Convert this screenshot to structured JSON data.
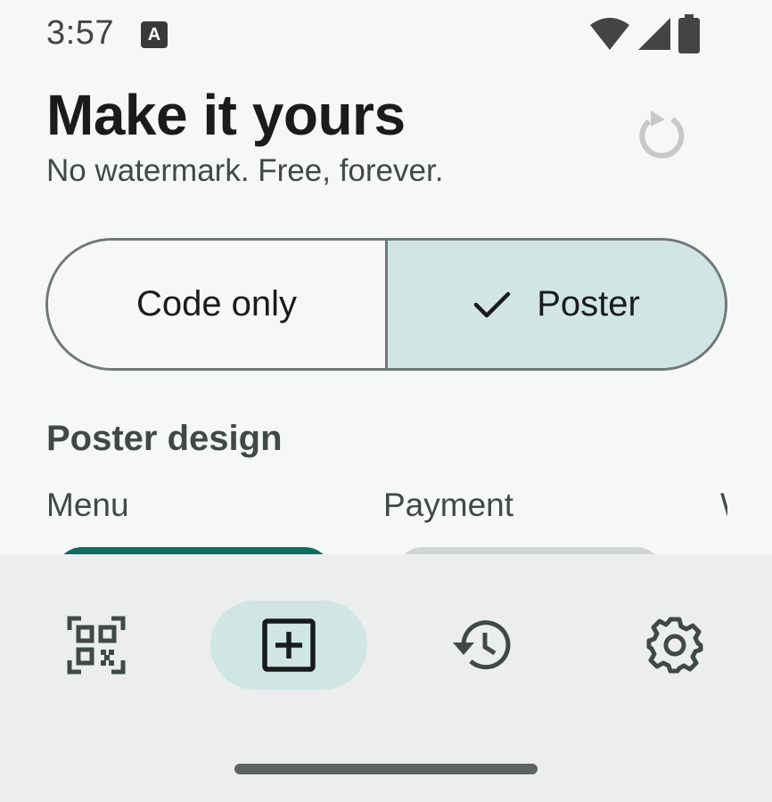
{
  "status": {
    "time": "3:57",
    "notification_badge": "A"
  },
  "header": {
    "title": "Make it yours",
    "subtitle": "No watermark. Free, forever."
  },
  "toggle": {
    "options": [
      {
        "label": "Code only",
        "selected": false
      },
      {
        "label": "Poster",
        "selected": true
      }
    ]
  },
  "poster": {
    "section_title": "Poster design",
    "designs": [
      "Menu",
      "Payment",
      "W"
    ]
  },
  "bottom_nav": {
    "items": [
      {
        "icon": "qr-scan-icon",
        "selected": false
      },
      {
        "icon": "add-box-icon",
        "selected": true
      },
      {
        "icon": "history-icon",
        "selected": false
      },
      {
        "icon": "gear-icon",
        "selected": false
      }
    ]
  },
  "colors": {
    "accent": "#0e6b63",
    "selected_bg": "#d1e6e4",
    "outline": "#6f7978"
  }
}
